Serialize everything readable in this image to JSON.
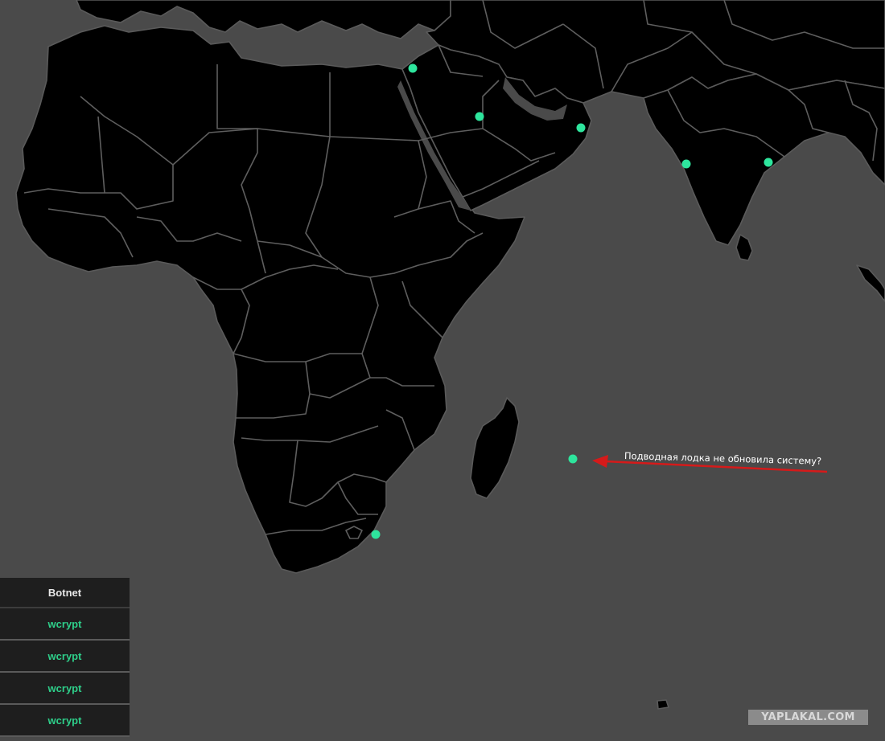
{
  "annotation": {
    "text": "Подводная лодка не обновила систему?",
    "arrow_color": "#d51a1a"
  },
  "panel": {
    "header": "Botnet",
    "rows": [
      "wcrypt",
      "wcrypt",
      "wcrypt",
      "wcrypt"
    ]
  },
  "watermark": "YAPLAKAL.COM",
  "colors": {
    "ocean": "#4a4a4a",
    "land": "#000000",
    "borders": "#5e5e5e",
    "marker": "#2ee59d",
    "panel_bg": "#1e1e1e",
    "panel_text": "#2ecf8a"
  }
}
